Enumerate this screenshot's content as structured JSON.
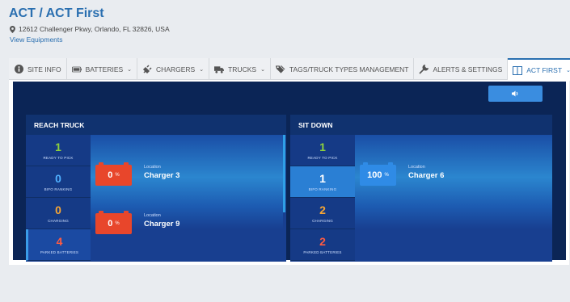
{
  "header": {
    "title": "ACT / ACT First",
    "address": "12612 Challenger Pkwy, Orlando, FL 32826, USA",
    "view_link": "View Equipments"
  },
  "tabs": [
    {
      "label": "SITE INFO",
      "icon": "info-icon"
    },
    {
      "label": "BATTERIES",
      "icon": "battery-icon",
      "dropdown": true
    },
    {
      "label": "CHARGERS",
      "icon": "plug-icon",
      "dropdown": true
    },
    {
      "label": "TRUCKS",
      "icon": "truck-icon",
      "dropdown": true
    },
    {
      "label": "TAGS/TRUCK TYPES MANAGEMENT",
      "icon": "tags-icon"
    },
    {
      "label": "ALERTS & SETTINGS",
      "icon": "wrench-icon"
    },
    {
      "label": "ACT FIRST",
      "icon": "columns-icon",
      "dropdown": true,
      "active": true
    }
  ],
  "caret": "⌄",
  "groups": {
    "reach": {
      "title": "REACH TRUCK",
      "stats": [
        {
          "value": "1",
          "label": "READY TO PICK",
          "color": "#8ed23c"
        },
        {
          "value": "0",
          "label": "BIFO RANKING",
          "color": "#4fb0ff"
        },
        {
          "value": "0",
          "label": "CHARGING",
          "color": "#f6a535"
        },
        {
          "value": "4",
          "label": "PARKED BATTERIES",
          "color": "#ff5b42"
        }
      ],
      "cards": [
        {
          "percent": "0",
          "unit": "%",
          "location_label": "Location",
          "location": "Charger 3"
        },
        {
          "percent": "0",
          "unit": "%",
          "location_label": "Location",
          "location": "Charger 9"
        }
      ]
    },
    "sit": {
      "title": "SIT DOWN",
      "stats": [
        {
          "value": "1",
          "label": "READY TO PICK",
          "color": "#8ed23c"
        },
        {
          "value": "1",
          "label": "BIFO RANKING",
          "color": "#ffffff"
        },
        {
          "value": "2",
          "label": "CHARGING",
          "color": "#f6a535"
        },
        {
          "value": "2",
          "label": "PARKED BATTERIES",
          "color": "#ff5b42"
        }
      ],
      "cards": [
        {
          "percent": "100",
          "unit": "%",
          "location_label": "Location",
          "location": "Charger 6"
        }
      ]
    }
  },
  "colors": {
    "brand": "#2a6fb0",
    "dashboard_bg": "#0b2556",
    "sound_button": "#3a8de0",
    "battery_empty": "#e8462b",
    "battery_full": "#2f8be6"
  }
}
